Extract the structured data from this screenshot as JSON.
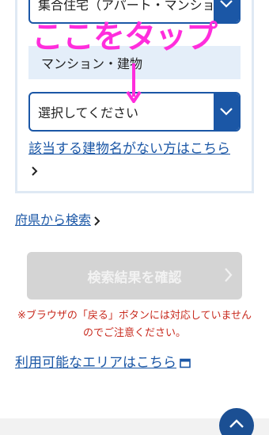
{
  "form": {
    "building_type_select": {
      "value": "集合住宅（アパート・マンション）"
    },
    "section_label": "マンション・建物",
    "building_select": {
      "value": "選択してください"
    },
    "building_missing_link": "該当する建物名がない方はこちら",
    "prefecture_search_link": "府県から検索",
    "confirm_button": "検索結果を確認",
    "notice": "※ブラウザの「戻る」ボタンには対応していませんのでご注意ください。",
    "area_link": "利用可能なエリアはこちら"
  },
  "overlay": {
    "text": "ここをタップ"
  },
  "colors": {
    "accent": "#1b57a6",
    "overlay": "#ff2ddc",
    "notice": "#c82a1e",
    "section_bg": "#e4eef9",
    "disabled_button": "#d4d4d4"
  },
  "icons": [
    "chevron-down-icon",
    "chevron-right-icon",
    "external-window-icon",
    "arrow-up-icon",
    "down-arrow-icon"
  ]
}
